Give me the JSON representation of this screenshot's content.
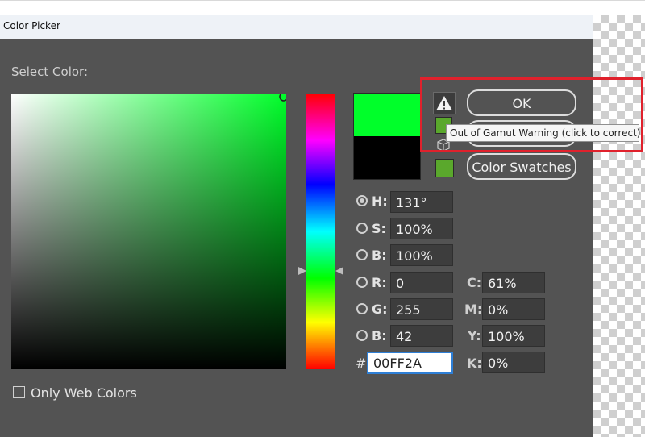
{
  "window": {
    "title": "Color Picker"
  },
  "picker": {
    "select_label": "Select Color:"
  },
  "fields": {
    "h": {
      "label": "H:",
      "value": "131°"
    },
    "s": {
      "label": "S:",
      "value": "100%"
    },
    "b": {
      "label": "B:",
      "value": "100%"
    },
    "r": {
      "label": "R:",
      "value": "0"
    },
    "g": {
      "label": "G:",
      "value": "255"
    },
    "blue": {
      "label": "B:",
      "value": "42"
    },
    "hex": {
      "label": "#",
      "value": "00FF2A"
    },
    "c": {
      "label": "C:",
      "value": "61%"
    },
    "m": {
      "label": "M:",
      "value": "0%"
    },
    "y": {
      "label": "Y:",
      "value": "100%"
    },
    "k": {
      "label": "K:",
      "value": "0%"
    }
  },
  "buttons": {
    "ok": "OK",
    "color_swatches": "Color Swatches"
  },
  "tooltip": {
    "text": "Out of Gamut Warning (click to correct)"
  },
  "only_web_colors": {
    "label": "Only Web Colors",
    "checked": false
  },
  "colors": {
    "new_color": "#00ff2a",
    "current_color": "#000000",
    "gamut_swatch": "#5aa82c",
    "highlight": "#e0212c"
  },
  "icons": {
    "gamut_warning": "warning-triangle-icon",
    "web_safe": "cube-icon"
  }
}
